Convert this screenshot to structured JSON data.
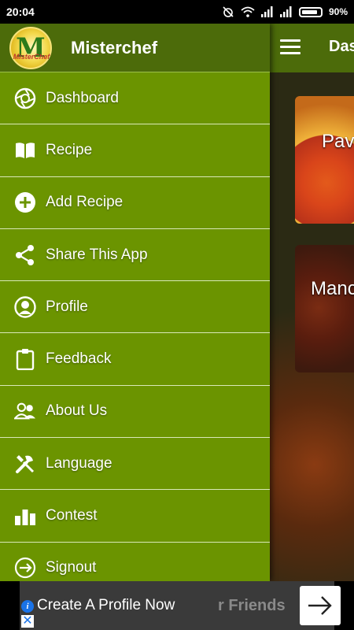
{
  "status_bar": {
    "time": "20:04",
    "battery": "90%"
  },
  "background_screen": {
    "title": "Das",
    "cards": [
      {
        "title": "Pav"
      },
      {
        "title": "Manc"
      }
    ]
  },
  "drawer": {
    "app_name": "Misterchef",
    "logo_mark": "M",
    "logo_text": "MisterChef",
    "items": [
      {
        "label": "Dashboard",
        "icon": "aperture-icon"
      },
      {
        "label": "Recipe",
        "icon": "book-icon"
      },
      {
        "label": "Add Recipe",
        "icon": "add-circle-icon"
      },
      {
        "label": "Share This App",
        "icon": "share-icon"
      },
      {
        "label": "Profile",
        "icon": "profile-icon"
      },
      {
        "label": "Feedback",
        "icon": "clipboard-icon"
      },
      {
        "label": "About Us",
        "icon": "people-icon"
      },
      {
        "label": "Language",
        "icon": "tools-icon"
      },
      {
        "label": "Contest",
        "icon": "podium-icon"
      },
      {
        "label": "Signout",
        "icon": "signout-icon"
      }
    ]
  },
  "ad": {
    "text": "Create A Profile Now",
    "background_text": "r Friends"
  },
  "colors": {
    "drawer": "#6b9400",
    "toolbar": "#4c6b0a"
  }
}
